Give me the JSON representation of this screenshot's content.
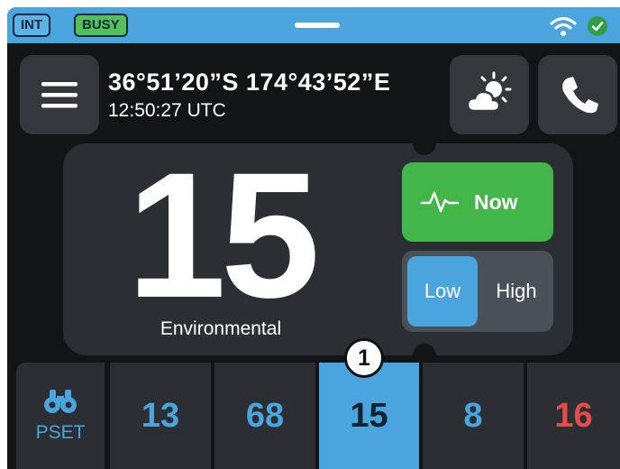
{
  "status_bar": {
    "badges": [
      "INT",
      "BUSY"
    ],
    "icons": [
      "wifi-icon",
      "check-circle-icon"
    ]
  },
  "header": {
    "menu_icon": "hamburger-menu-icon",
    "coordinates": "36°51’20”S  174°43’52”E",
    "time": "12:50:27 UTC",
    "weather_icon": "sun-cloud-icon",
    "phone_icon": "phone-icon"
  },
  "channel_display": {
    "number": "15",
    "label": "Environmental"
  },
  "controls": {
    "now_label": "Now",
    "now_icon": "signal-pulse-icon",
    "power": {
      "options": [
        "Low",
        "High"
      ],
      "selected": "Low"
    }
  },
  "channel_bar": {
    "pset_label": "PSET",
    "pset_icon": "binoculars-icon",
    "channels": [
      "13",
      "68",
      "15",
      "8",
      "16"
    ],
    "active_channel": "15",
    "emergency_channel": "16"
  },
  "callout_marker": "1",
  "colors": {
    "accent_blue": "#4aa4de",
    "green": "#43b649",
    "emergency_red": "#e64b4b",
    "background": "#121416",
    "panel": "#2b2f34"
  }
}
